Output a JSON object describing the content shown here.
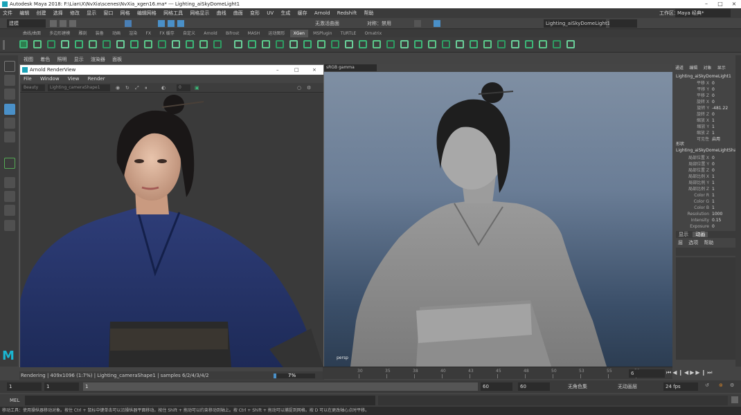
{
  "window": {
    "title": "Autodesk Maya 2018: F:\\Lian\\X\\NvXia\\scenes\\NvXia_xgen16.ma*   ---   Lighting_aiSkyDomeLight1",
    "controls": [
      "–",
      "□",
      "×"
    ]
  },
  "menubar": {
    "items": [
      "文件",
      "编辑",
      "创建",
      "选择",
      "修改",
      "显示",
      "窗口",
      "网格",
      "编辑网格",
      "网格工具",
      "网格显示",
      "曲线",
      "曲面",
      "变形",
      "UV",
      "生成",
      "缓存",
      "Arnold",
      "Redshift",
      "帮助"
    ],
    "workspace_label": "工作区：",
    "workspace_value": "Maya 经典*"
  },
  "statusline": {
    "mode": "建模",
    "no_live": "无激活曲面",
    "symmetry": "对称：禁用",
    "selected_light": "Lighting_aiSkyDomeLight1"
  },
  "shelf": {
    "tabs": [
      "曲线/曲面",
      "多边形建模",
      "雕刻",
      "装备",
      "动画",
      "渲染",
      "FX",
      "FX 缓存",
      "自定义",
      "Arnold",
      "Bifrost",
      "MASH",
      "运动图形",
      "XGen",
      "MSPlugin",
      "TURTLE",
      "Ornatrix"
    ],
    "active_tab": "XGen"
  },
  "viewport": {
    "menu": [
      "视图",
      "着色",
      "照明",
      "显示",
      "渲染器",
      "面板"
    ],
    "colorspace": "sRGB gamma",
    "camera_label": "persp"
  },
  "render_view": {
    "title": "Arnold RenderView",
    "menu": [
      "File",
      "Window",
      "View",
      "Render"
    ],
    "aov": "Beauty",
    "camera": "Lighting_cameraShape1",
    "exposure": "0",
    "status": "Rendering | 409x1096 (1:7%) | Lighting_cameraShape1 | samples 6/2/4/3/4/2",
    "progress": 7,
    "progress_label": "7%"
  },
  "attribute_editor": {
    "tabs": [
      "通道",
      "编辑",
      "对象",
      "显示"
    ],
    "node_name": "Lighting_aiSkyDomeLight1",
    "rows": [
      {
        "k": "平移 X",
        "v": "0"
      },
      {
        "k": "平移 Y",
        "v": "0"
      },
      {
        "k": "平移 Z",
        "v": "0"
      },
      {
        "k": "旋转 X",
        "v": "0"
      },
      {
        "k": "旋转 Y",
        "v": "-481.22"
      },
      {
        "k": "旋转 Z",
        "v": "0"
      },
      {
        "k": "缩放 X",
        "v": "1"
      },
      {
        "k": "缩放 Y",
        "v": "1"
      },
      {
        "k": "缩放 Z",
        "v": "1"
      },
      {
        "k": "可见性",
        "v": "启用"
      }
    ],
    "shapes_label": "形状",
    "shape_name": "Lighting_aiSkyDomeLightShape1",
    "shape_rows": [
      {
        "k": "局部位置 X",
        "v": "0"
      },
      {
        "k": "局部位置 Y",
        "v": "0"
      },
      {
        "k": "局部位置 Z",
        "v": "0"
      },
      {
        "k": "局部比例 X",
        "v": "1"
      },
      {
        "k": "局部比例 Y",
        "v": "1"
      },
      {
        "k": "局部比例 Z",
        "v": "1"
      },
      {
        "k": "Color R",
        "v": "1"
      },
      {
        "k": "Color G",
        "v": "1"
      },
      {
        "k": "Color B",
        "v": "1"
      },
      {
        "k": "Resolution",
        "v": "1000"
      },
      {
        "k": "Intensity",
        "v": "0.15"
      },
      {
        "k": "Exposure",
        "v": "0"
      }
    ],
    "layer_tabs": [
      "显示",
      "动画"
    ],
    "layer_menu": [
      "层",
      "选项",
      "帮助"
    ]
  },
  "timeline": {
    "ticks": [
      "30",
      "35",
      "38",
      "40",
      "43",
      "45",
      "48",
      "50",
      "53",
      "55",
      "58"
    ],
    "current_frame": "6",
    "fps": "24 fps"
  },
  "range": {
    "start": "1",
    "start2": "1",
    "current": "1",
    "end": "60",
    "end2": "60",
    "end3": "60",
    "char_set": "无角色集",
    "anim_layer": "无动画层"
  },
  "mel": {
    "label": "MEL"
  },
  "help_line": "移动工具：使用操纵器移动对象。按住 Ctrl + 鼠标中键单击可以沿操纵器平面移动。按住 Shift + 拖动可以约束移动到轴上。按 Ctrl + Shift + 拖动可以捕捉到网格。按 D 可以在更改轴心点时平移。",
  "colors": {
    "xgen_icon": "#3cb878",
    "accent": "#4a90c8"
  }
}
